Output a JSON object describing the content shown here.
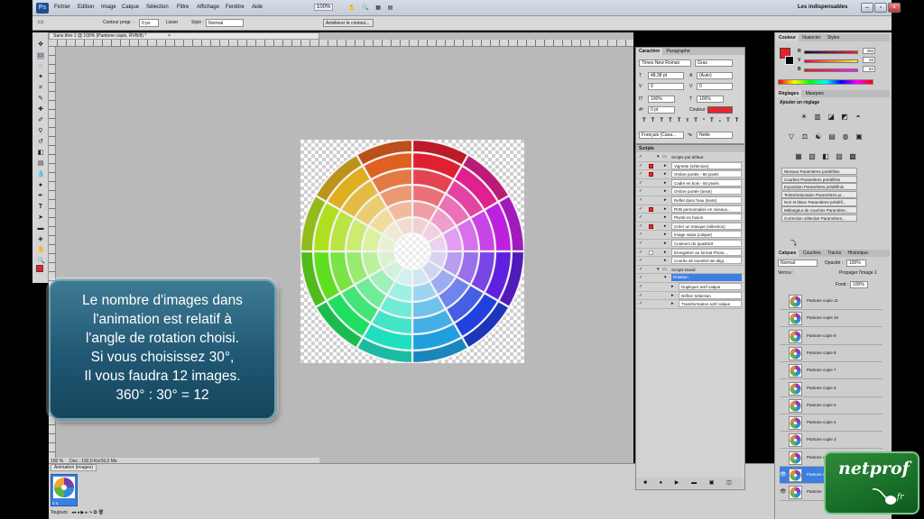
{
  "menubar": {
    "app_icon": "Ps",
    "items": [
      "Fichier",
      "Edition",
      "Image",
      "Calque",
      "Sélection",
      "Filtre",
      "Affichage",
      "Fenêtre",
      "Aide"
    ],
    "zoom": "100%",
    "workspace": "Les indispensables",
    "window_buttons": [
      "minimize-icon",
      "restore-icon",
      "close-icon"
    ]
  },
  "options_bar": {
    "contour_label": "Contour progr. :",
    "contour_value": "0 px",
    "lisser_label": "Lisser",
    "style_label": "Style :",
    "style_value": "Normal",
    "refine_button": "Améliorer le contour..."
  },
  "document": {
    "tab_title": "Sans titre-1 @ 100% (Pantone copie, RVB/8) *",
    "status_zoom": "100 %",
    "status_info": "Doc : 192,0 Ko/16,0 Mo"
  },
  "infobox": {
    "lines": [
      "Le nombre d'images dans",
      "l'animation est relatif à",
      "l'angle de rotation choisi.",
      "Si vous choisissez 30°,",
      "Il vous faudra 12 images.",
      "360° : 30° = 12"
    ]
  },
  "animation_panel": {
    "tab": "Animation (images)",
    "frame_delay": "0 s.",
    "loop": "Toujours"
  },
  "character_panel": {
    "tabs": [
      "Caractère",
      "Paragraphe"
    ],
    "font_family": "Times New Roman",
    "font_style": "Gras",
    "font_size": "48,38 pt",
    "leading": "(Auto)",
    "kerning": "0",
    "tracking": "0",
    "vscale": "100%",
    "hscale": "100%",
    "baseline": "0 pt",
    "color_label": "Couleur :",
    "color": "#e52630",
    "type_buttons": [
      "T",
      "T",
      "TT",
      "Tт",
      "T¹",
      "T₁",
      "T",
      "T"
    ],
    "language": "Français (Cana...",
    "antialias": "Nette"
  },
  "actions_panel": {
    "tab": "Scripts",
    "rows": [
      {
        "level": 0,
        "label": "Scripts par défaut",
        "dlg": "none",
        "folder": true
      },
      {
        "level": 1,
        "label": "Vignette (sélection)",
        "dlg": "red"
      },
      {
        "level": 1,
        "label": "Ombre portée - 50 pixels",
        "dlg": "red"
      },
      {
        "level": 1,
        "label": "Cadre en bois - 50 pixels",
        "dlg": "none"
      },
      {
        "level": 1,
        "label": "Ombre portée (texte)",
        "dlg": "none"
      },
      {
        "level": 1,
        "label": "Reflet dans l'eau (texte)",
        "dlg": "none"
      },
      {
        "level": 1,
        "label": "RVB personnalisé en niveaux...",
        "dlg": "red"
      },
      {
        "level": 1,
        "label": "Plomb en fusion",
        "dlg": "none"
      },
      {
        "level": 1,
        "label": "Créer un masque (sélection)",
        "dlg": "red"
      },
      {
        "level": 1,
        "label": "Image sépia (calque)",
        "dlg": "none"
      },
      {
        "level": 1,
        "label": "Couleurs du quadrant",
        "dlg": "none"
      },
      {
        "level": 1,
        "label": "Enregistrer au format Photo...",
        "dlg": "box"
      },
      {
        "level": 1,
        "label": "Courbe de transfert de dégr...",
        "dlg": "none"
      },
      {
        "level": 0,
        "label": "Scripts David",
        "dlg": "none",
        "folder": true
      },
      {
        "level": 1,
        "label": "Rotation",
        "dlg": "none",
        "selected": true
      },
      {
        "level": 2,
        "label": "Dupliquer actif calque",
        "dlg": "none"
      },
      {
        "level": 2,
        "label": "Définir Sélection",
        "dlg": "none"
      },
      {
        "level": 2,
        "label": "Transformation actif calque",
        "dlg": "none"
      }
    ],
    "footer_icons": "■ ● ▶ ▬ ▣ ◫"
  },
  "color_panel": {
    "tabs": [
      "Couleur",
      "Nuancier",
      "Styles"
    ],
    "foreground": "#e8202a",
    "channels": [
      {
        "name": "R",
        "value": "255"
      },
      {
        "name": "V",
        "value": "26"
      },
      {
        "name": "B",
        "value": "52"
      }
    ]
  },
  "adjust_panel": {
    "tabs": [
      "Réglages",
      "Masques"
    ],
    "title": "Ajouter un réglage",
    "icons_row1": [
      "☀",
      "▥",
      "◪",
      "◩",
      "◓"
    ],
    "icons_row2": [
      "▽",
      "⚖",
      "☯",
      "▤",
      "◍",
      "▣"
    ],
    "icons_row3": [
      "▦",
      "▧",
      "◧",
      "▨",
      "▩"
    ],
    "presets": [
      "Niveaux Paramètres prédéfinis",
      "Courbes Paramètres prédéfinis",
      "Exposition Paramètres prédéfinis",
      "Teinte/Saturation Paramètres pr...",
      "Noir et blanc Paramètres prédéfi...",
      "Mélangeur de couches Paramètre...",
      "Correction sélective Paramètres..."
    ]
  },
  "layers_panel": {
    "tabs": [
      "Calques",
      "Couches",
      "Tracés",
      "Historique"
    ],
    "blend_mode": "Normal",
    "opacity_label": "Opacité :",
    "opacity": "100%",
    "lock_label": "Verrou :",
    "propagate_label": "Propager l'image 1",
    "fill_label": "Fond :",
    "fill": "100%",
    "layers": [
      {
        "name": "Pantone copie 11",
        "selected": false
      },
      {
        "name": "Pantone copie 10",
        "selected": false
      },
      {
        "name": "Pantone copie 9",
        "selected": false
      },
      {
        "name": "Pantone copie 8",
        "selected": false
      },
      {
        "name": "Pantone copie 7",
        "selected": false
      },
      {
        "name": "Pantone copie 6",
        "selected": false
      },
      {
        "name": "Pantone copie 5",
        "selected": false
      },
      {
        "name": "Pantone copie 4",
        "selected": false
      },
      {
        "name": "Pantone copie 3",
        "selected": false
      },
      {
        "name": "Pantone copie 2",
        "selected": false
      },
      {
        "name": "Pantone copie",
        "selected": true
      },
      {
        "name": "Pantone",
        "selected": false
      }
    ]
  },
  "watermark": {
    "text": "netprof",
    "sub": ".fr"
  },
  "wheel": {
    "hues": [
      355,
      325,
      290,
      260,
      230,
      200,
      170,
      140,
      100,
      75,
      45,
      20
    ],
    "accent_bg": "#b9b9b9"
  }
}
